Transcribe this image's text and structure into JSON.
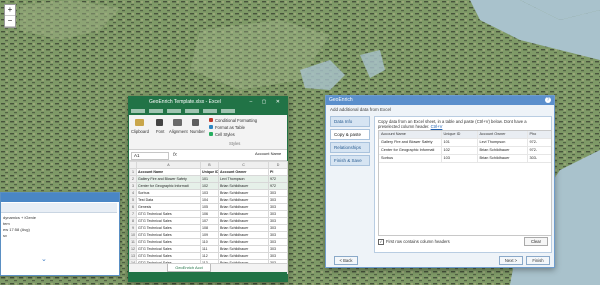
{
  "excel": {
    "title": "GeoEnrich Template.xlsx - Excel",
    "ribbon": {
      "clipboard": "Clipboard",
      "font": "Font",
      "alignment": "Alignment",
      "number": "Number",
      "cond_format": "Conditional Formatting",
      "format_table": "Format as Table",
      "cell_styles": "Cell Styles",
      "styles_group": "Styles"
    },
    "name_box": "A1",
    "fx": "fx",
    "formula_value": "Account Name",
    "columns": [
      "",
      "A",
      "B",
      "C",
      "D"
    ],
    "rows": [
      {
        "num": "1",
        "cells": [
          "Account Name",
          "Unique ID",
          "Account Owner",
          "Pl"
        ],
        "header": true
      },
      {
        "num": "2",
        "cells": [
          "Gallery Fire and Blower Safety",
          "101",
          "Levi Thompson",
          "972"
        ],
        "selected": true
      },
      {
        "num": "3",
        "cells": [
          "Center for Geographic Informati",
          "102",
          "Brian Schildhauer",
          "972"
        ],
        "selected": true
      },
      {
        "num": "4",
        "cells": [
          "Sorbus",
          "103",
          "Brian Schildhauer",
          "303"
        ]
      },
      {
        "num": "5",
        "cells": [
          "Test Data",
          "104",
          "Brian Schildhauer",
          "303"
        ]
      },
      {
        "num": "6",
        "cells": [
          "Genesis",
          "105",
          "Brian Schildhauer",
          "303"
        ]
      },
      {
        "num": "7",
        "cells": [
          "GTG Technical Sales",
          "106",
          "Brian Schildhauer",
          "303"
        ]
      },
      {
        "num": "8",
        "cells": [
          "GTG Technical Sales",
          "107",
          "Brian Schildhauer",
          "303"
        ]
      },
      {
        "num": "9",
        "cells": [
          "GTG Technical Sales",
          "108",
          "Brian Schildhauer",
          "303"
        ]
      },
      {
        "num": "10",
        "cells": [
          "GTG Technical Sales",
          "109",
          "Brian Schildhauer",
          "303"
        ]
      },
      {
        "num": "11",
        "cells": [
          "GTG Technical Sales",
          "110",
          "Brian Schildhauer",
          "303"
        ]
      },
      {
        "num": "12",
        "cells": [
          "GTG Technical Sales",
          "111",
          "Brian Schildhauer",
          "303"
        ]
      },
      {
        "num": "13",
        "cells": [
          "GTG Technical Sales",
          "112",
          "Brian Schildhauer",
          "303"
        ]
      },
      {
        "num": "14",
        "cells": [
          "GTG Technical Sales",
          "113",
          "Brian Schildhauer",
          "303"
        ]
      },
      {
        "num": "15",
        "cells": [
          "",
          "",
          "",
          ""
        ]
      }
    ],
    "sheet_tab": "GeoEnrich Acct"
  },
  "wizard": {
    "title": "GeoEnrich",
    "subtitle": "Add additional data from Excel",
    "steps": [
      {
        "label": "Data Info",
        "active": false
      },
      {
        "label": "Copy & paste",
        "active": true
      },
      {
        "label": "Relationships",
        "active": false
      },
      {
        "label": "Finish & Save",
        "active": false
      }
    ],
    "description": "Copy data from an Excel sheet, in a table and paste (Ctrl+V) below. Dont have a preselected column header.",
    "desc_link": "Ctrl+V",
    "table": {
      "headers": [
        "Account Name",
        "Unique ID",
        "Account Owner",
        "Pho"
      ],
      "rows": [
        [
          "Gallery Fire and Blower Safety",
          "101",
          "Levi Thompson",
          "972-"
        ],
        [
          "Center for Geographic Informati",
          "102",
          "Brian Schildhauer",
          "972-"
        ],
        [
          "Sorbus",
          "103",
          "Brian Schildhauer",
          "303-"
        ]
      ]
    },
    "checkbox_label": "First row contains column headers",
    "checkbox_checked": true,
    "clear_label": "Clear",
    "back_label": "< Back",
    "next_label": "Next >",
    "finish_label": "Finish"
  },
  "left_panel": {
    "line1": "dynamics + iGenie",
    "line2": "tem",
    "line3": "ew 17:58 (Avg)",
    "line4": "sv"
  },
  "colors": {
    "excel_green": "#217346",
    "wizard_blue": "#5b8fcc",
    "map_water": "#a9c2cc",
    "map_land": "#7f9a67"
  }
}
